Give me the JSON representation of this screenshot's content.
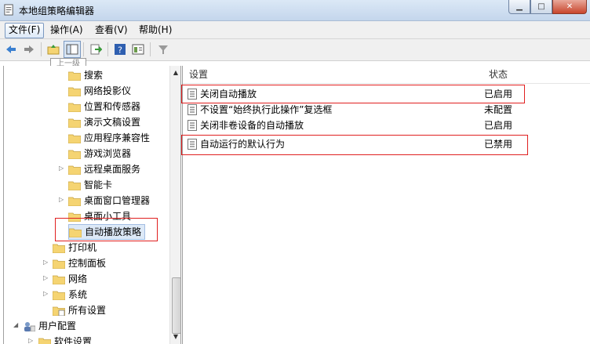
{
  "window": {
    "title": "本地组策略编辑器"
  },
  "menubar": {
    "items": [
      "文件(F)",
      "操作(A)",
      "查看(V)",
      "帮助(H)"
    ]
  },
  "toolbar": {
    "tooltip": "上一级"
  },
  "tree": {
    "items": [
      {
        "label": "搜索"
      },
      {
        "label": "网络投影仪"
      },
      {
        "label": "位置和传感器"
      },
      {
        "label": "演示文稿设置"
      },
      {
        "label": "应用程序兼容性"
      },
      {
        "label": "游戏浏览器"
      },
      {
        "label": "远程桌面服务"
      },
      {
        "label": "智能卡"
      },
      {
        "label": "桌面窗口管理器"
      },
      {
        "label": "桌面小工具"
      },
      {
        "label": "自动播放策略"
      },
      {
        "label": "打印机"
      },
      {
        "label": "控制面板"
      },
      {
        "label": "网络"
      },
      {
        "label": "系统"
      },
      {
        "label": "所有设置"
      },
      {
        "label": "用户配置"
      },
      {
        "label": "软件设置"
      }
    ]
  },
  "list": {
    "headers": {
      "setting": "设置",
      "state": "状态"
    },
    "rows": [
      {
        "name": "关闭自动播放",
        "state": "已启用"
      },
      {
        "name": "不设置“始终执行此操作”复选框",
        "state": "未配置"
      },
      {
        "name": "关闭非卷设备的自动播放",
        "state": "已启用"
      },
      {
        "name": "自动运行的默认行为",
        "state": "已禁用"
      }
    ]
  },
  "colors": {
    "highlight": "#e02020",
    "folder": "#f5d472"
  }
}
